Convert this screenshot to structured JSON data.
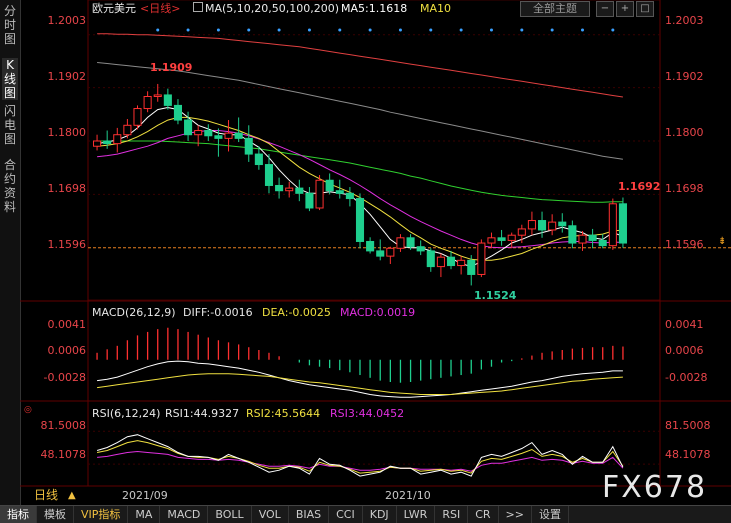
{
  "sidebar": {
    "tabs": [
      {
        "label": "分时图",
        "active": false
      },
      {
        "label": "K线图",
        "active": true
      },
      {
        "label": "闪电图",
        "active": false
      },
      {
        "label": "合约资料",
        "active": false
      }
    ]
  },
  "header": {
    "symbol": "欧元美元",
    "period": "<日线>",
    "ma_params": "MA(5,10,20,50,100,200)",
    "ma5": "MA5:1.1618",
    "ma10": "MA10",
    "theme_button": "全部主题",
    "controls": [
      "−",
      "+",
      "□"
    ]
  },
  "price_axis": {
    "labels": [
      "1.2003",
      "1.1902",
      "1.1800",
      "1.1698",
      "1.1596"
    ],
    "high_label": "1.1909",
    "low_label": "1.1524",
    "last_label": "1.1692"
  },
  "macd": {
    "title": "MACD(26,12,9)",
    "diff": "DIFF:-0.0016",
    "dea": "DEA:-0.0025",
    "macd": "MACD:0.0019",
    "axis": [
      "0.0041",
      "0.0006",
      "-0.0028"
    ]
  },
  "rsi": {
    "title": "RSI(6,12,24)",
    "rsi1": "RSI1:44.9327",
    "rsi2": "RSI2:45.5644",
    "rsi3": "RSI3:44.0452",
    "axis": [
      "81.5008",
      "48.1078"
    ]
  },
  "time_axis": {
    "period_label": "日线",
    "months": [
      "2021/09",
      "2021/10"
    ]
  },
  "bottom_tabs": [
    "指标",
    "模板",
    "VIP指标",
    "MA",
    "MACD",
    "BOLL",
    "VOL",
    "BIAS",
    "CCI",
    "KDJ",
    "LWR",
    "RSI",
    "CR",
    ">>",
    "设置"
  ],
  "watermark": "FX678",
  "colors": {
    "up": "#ff3030",
    "down": "#1ecf8e",
    "ma5": "#ffffff",
    "ma10": "#f0e040",
    "ma20": "#e030e0",
    "ma50": "#30d030",
    "ma100": "#8a8a8a",
    "ma200": "#e04040",
    "macd_dea": "#f0e040",
    "rsi2": "#f0e040",
    "rsi3": "#e030e0"
  },
  "chart_data": {
    "type": "candlestick",
    "ylim": [
      1.15,
      1.2035
    ],
    "candles": [
      {
        "o": 1.179,
        "h": 1.1812,
        "l": 1.1782,
        "c": 1.18
      },
      {
        "o": 1.18,
        "h": 1.182,
        "l": 1.1785,
        "c": 1.1795
      },
      {
        "o": 1.1795,
        "h": 1.1825,
        "l": 1.1778,
        "c": 1.1812
      },
      {
        "o": 1.1812,
        "h": 1.1842,
        "l": 1.1805,
        "c": 1.183
      },
      {
        "o": 1.183,
        "h": 1.1868,
        "l": 1.1822,
        "c": 1.1862
      },
      {
        "o": 1.1862,
        "h": 1.1895,
        "l": 1.1855,
        "c": 1.1885
      },
      {
        "o": 1.1885,
        "h": 1.1909,
        "l": 1.1875,
        "c": 1.1888
      },
      {
        "o": 1.1888,
        "h": 1.19,
        "l": 1.186,
        "c": 1.1868
      },
      {
        "o": 1.1868,
        "h": 1.188,
        "l": 1.1832,
        "c": 1.184
      },
      {
        "o": 1.184,
        "h": 1.1856,
        "l": 1.18,
        "c": 1.1812
      },
      {
        "o": 1.1812,
        "h": 1.183,
        "l": 1.179,
        "c": 1.182
      },
      {
        "o": 1.182,
        "h": 1.1832,
        "l": 1.18,
        "c": 1.181
      },
      {
        "o": 1.181,
        "h": 1.1824,
        "l": 1.177,
        "c": 1.1805
      },
      {
        "o": 1.1805,
        "h": 1.184,
        "l": 1.178,
        "c": 1.1815
      },
      {
        "o": 1.1815,
        "h": 1.1845,
        "l": 1.1798,
        "c": 1.1805
      },
      {
        "o": 1.1805,
        "h": 1.183,
        "l": 1.176,
        "c": 1.1775
      },
      {
        "o": 1.1775,
        "h": 1.179,
        "l": 1.1745,
        "c": 1.1755
      },
      {
        "o": 1.1755,
        "h": 1.1775,
        "l": 1.17,
        "c": 1.1715
      },
      {
        "o": 1.1715,
        "h": 1.173,
        "l": 1.169,
        "c": 1.1705
      },
      {
        "o": 1.1705,
        "h": 1.1722,
        "l": 1.1692,
        "c": 1.171
      },
      {
        "o": 1.171,
        "h": 1.1726,
        "l": 1.1685,
        "c": 1.17
      },
      {
        "o": 1.17,
        "h": 1.1712,
        "l": 1.1666,
        "c": 1.1672
      },
      {
        "o": 1.1672,
        "h": 1.1735,
        "l": 1.1668,
        "c": 1.1725
      },
      {
        "o": 1.1725,
        "h": 1.1738,
        "l": 1.1698,
        "c": 1.1705
      },
      {
        "o": 1.1705,
        "h": 1.1726,
        "l": 1.169,
        "c": 1.17
      },
      {
        "o": 1.17,
        "h": 1.1712,
        "l": 1.1675,
        "c": 1.169
      },
      {
        "o": 1.169,
        "h": 1.17,
        "l": 1.1595,
        "c": 1.1608
      },
      {
        "o": 1.1608,
        "h": 1.1616,
        "l": 1.1585,
        "c": 1.159
      },
      {
        "o": 1.159,
        "h": 1.1612,
        "l": 1.1572,
        "c": 1.158
      },
      {
        "o": 1.158,
        "h": 1.1598,
        "l": 1.1565,
        "c": 1.1595
      },
      {
        "o": 1.1595,
        "h": 1.1622,
        "l": 1.1588,
        "c": 1.1615
      },
      {
        "o": 1.1615,
        "h": 1.1622,
        "l": 1.1592,
        "c": 1.1598
      },
      {
        "o": 1.1598,
        "h": 1.161,
        "l": 1.1582,
        "c": 1.159
      },
      {
        "o": 1.159,
        "h": 1.1595,
        "l": 1.155,
        "c": 1.156
      },
      {
        "o": 1.156,
        "h": 1.1585,
        "l": 1.154,
        "c": 1.1578
      },
      {
        "o": 1.1578,
        "h": 1.159,
        "l": 1.1555,
        "c": 1.1562
      },
      {
        "o": 1.1562,
        "h": 1.158,
        "l": 1.1545,
        "c": 1.1572
      },
      {
        "o": 1.1572,
        "h": 1.1582,
        "l": 1.1524,
        "c": 1.1545
      },
      {
        "o": 1.1545,
        "h": 1.1612,
        "l": 1.154,
        "c": 1.1605
      },
      {
        "o": 1.1605,
        "h": 1.1625,
        "l": 1.1595,
        "c": 1.1615
      },
      {
        "o": 1.1615,
        "h": 1.163,
        "l": 1.16,
        "c": 1.161
      },
      {
        "o": 1.161,
        "h": 1.1625,
        "l": 1.1595,
        "c": 1.162
      },
      {
        "o": 1.162,
        "h": 1.164,
        "l": 1.1605,
        "c": 1.1632
      },
      {
        "o": 1.1632,
        "h": 1.1665,
        "l": 1.162,
        "c": 1.1648
      },
      {
        "o": 1.1648,
        "h": 1.1665,
        "l": 1.1615,
        "c": 1.163
      },
      {
        "o": 1.163,
        "h": 1.166,
        "l": 1.162,
        "c": 1.1645
      },
      {
        "o": 1.1645,
        "h": 1.1662,
        "l": 1.1625,
        "c": 1.1638
      },
      {
        "o": 1.1638,
        "h": 1.1648,
        "l": 1.1595,
        "c": 1.1605
      },
      {
        "o": 1.1605,
        "h": 1.1628,
        "l": 1.159,
        "c": 1.162
      },
      {
        "o": 1.162,
        "h": 1.1632,
        "l": 1.1595,
        "c": 1.161
      },
      {
        "o": 1.161,
        "h": 1.1622,
        "l": 1.1595,
        "c": 1.16
      },
      {
        "o": 1.16,
        "h": 1.169,
        "l": 1.1592,
        "c": 1.168
      },
      {
        "o": 1.168,
        "h": 1.1692,
        "l": 1.1596,
        "c": 1.1605
      }
    ],
    "ma5": [
      1.1795,
      1.1798,
      1.1802,
      1.181,
      1.1825,
      1.1845,
      1.186,
      1.1864,
      1.186,
      1.1845,
      1.183,
      1.1823,
      1.1815,
      1.1812,
      1.1812,
      1.18,
      1.1788,
      1.1768,
      1.1745,
      1.1725,
      1.1708,
      1.17,
      1.17,
      1.1703,
      1.17,
      1.1697,
      1.168,
      1.166,
      1.1636,
      1.1612,
      1.1598,
      1.1596,
      1.1596,
      1.159,
      1.1585,
      1.1576,
      1.1566,
      1.156,
      1.157,
      1.158,
      1.1592,
      1.1605,
      1.1612,
      1.162,
      1.1625,
      1.163,
      1.1635,
      1.163,
      1.1625,
      1.1615,
      1.1612,
      1.1625,
      1.1618
    ],
    "ma10": [
      1.179,
      1.1792,
      1.1795,
      1.18,
      1.1808,
      1.1818,
      1.183,
      1.184,
      1.1845,
      1.1845,
      1.1842,
      1.1838,
      1.1832,
      1.1826,
      1.182,
      1.1812,
      1.1805,
      1.1795,
      1.178,
      1.1765,
      1.175,
      1.1738,
      1.1728,
      1.1718,
      1.171,
      1.1702,
      1.1692,
      1.168,
      1.1668,
      1.1655,
      1.164,
      1.1626,
      1.1615,
      1.1603,
      1.1595,
      1.1588,
      1.158,
      1.1574,
      1.1572,
      1.1572,
      1.1575,
      1.158,
      1.1585,
      1.1593,
      1.16,
      1.1608,
      1.1615,
      1.1618,
      1.162,
      1.162,
      1.1622,
      1.1628,
      1.163
    ],
    "ma20": [
      1.177,
      1.1772,
      1.1775,
      1.178,
      1.1785,
      1.179,
      1.1797,
      1.1805,
      1.181,
      1.1815,
      1.1818,
      1.182,
      1.182,
      1.1818,
      1.1815,
      1.181,
      1.1804,
      1.1797,
      1.179,
      1.1782,
      1.1774,
      1.1765,
      1.1755,
      1.1745,
      1.1736,
      1.1726,
      1.1715,
      1.1703,
      1.169,
      1.1678,
      1.1667,
      1.1656,
      1.1646,
      1.1637,
      1.1628,
      1.162,
      1.1612,
      1.1605,
      1.16,
      1.1597,
      1.1596,
      1.1597,
      1.1598,
      1.16,
      1.1602,
      1.1605,
      1.1607,
      1.1608,
      1.1608,
      1.1606,
      1.1605,
      1.1607,
      1.1606
    ],
    "ma50": [
      1.18,
      1.18,
      1.18,
      1.18,
      1.18,
      1.18,
      1.18,
      1.1799,
      1.1798,
      1.1797,
      1.1796,
      1.1795,
      1.1793,
      1.1791,
      1.1789,
      1.1787,
      1.1785,
      1.1782,
      1.1779,
      1.1776,
      1.1773,
      1.177,
      1.1767,
      1.1764,
      1.1761,
      1.1758,
      1.1754,
      1.175,
      1.1746,
      1.1742,
      1.1738,
      1.1733,
      1.1729,
      1.1724,
      1.1719,
      1.1714,
      1.171,
      1.1706,
      1.1702,
      1.1699,
      1.1696,
      1.1694,
      1.1692,
      1.169,
      1.1688,
      1.1687,
      1.1686,
      1.1685,
      1.1684,
      1.1683,
      1.1683,
      1.1684,
      1.1684
    ],
    "ma100": [
      1.195,
      1.1948,
      1.1946,
      1.1944,
      1.1942,
      1.194,
      1.1938,
      1.1936,
      1.1934,
      1.1931,
      1.1928,
      1.1925,
      1.1922,
      1.1919,
      1.1916,
      1.1912,
      1.1908,
      1.1904,
      1.19,
      1.1896,
      1.1892,
      1.1888,
      1.1884,
      1.188,
      1.1876,
      1.1872,
      1.1868,
      1.1864,
      1.186,
      1.1855,
      1.1851,
      1.1847,
      1.1843,
      1.1839,
      1.1835,
      1.1831,
      1.1827,
      1.1823,
      1.1819,
      1.1815,
      1.1811,
      1.1807,
      1.1803,
      1.1799,
      1.1795,
      1.1791,
      1.1787,
      1.1783,
      1.1779,
      1.1775,
      1.1771,
      1.1768,
      1.1765
    ],
    "ma200": [
      1.2005,
      1.2005,
      1.2004,
      1.2004,
      1.2003,
      1.2003,
      1.2002,
      1.2001,
      1.2,
      1.1999,
      1.1998,
      1.1997,
      1.1996,
      1.1994,
      1.1992,
      1.199,
      1.1988,
      1.1986,
      1.1984,
      1.1982,
      1.198,
      1.1977,
      1.1974,
      1.1971,
      1.1968,
      1.1965,
      1.1962,
      1.1959,
      1.1956,
      1.1953,
      1.195,
      1.1947,
      1.1944,
      1.1941,
      1.1938,
      1.1935,
      1.1932,
      1.1929,
      1.1926,
      1.1923,
      1.192,
      1.1917,
      1.1914,
      1.1911,
      1.1908,
      1.1905,
      1.1902,
      1.1899,
      1.1896,
      1.1893,
      1.189,
      1.1887,
      1.1884
    ],
    "macd_ylim": [
      -0.0055,
      0.006
    ],
    "macd_hist": [
      0.001,
      0.0015,
      0.002,
      0.0028,
      0.0035,
      0.004,
      0.0044,
      0.0046,
      0.0044,
      0.004,
      0.0036,
      0.0032,
      0.0028,
      0.0025,
      0.0022,
      0.0018,
      0.0014,
      0.001,
      0.0005,
      0.0,
      -0.0004,
      -0.0008,
      -0.001,
      -0.0012,
      -0.0015,
      -0.0018,
      -0.0022,
      -0.0026,
      -0.003,
      -0.0032,
      -0.0033,
      -0.0032,
      -0.003,
      -0.0028,
      -0.0026,
      -0.0024,
      -0.0022,
      -0.002,
      -0.0014,
      -0.001,
      -0.0004,
      -0.0002,
      0.0002,
      0.0006,
      0.001,
      0.0012,
      0.0014,
      0.0016,
      0.0017,
      0.0018,
      0.0018,
      0.002,
      0.0019
    ],
    "macd_diff": [
      -0.003,
      -0.0028,
      -0.0025,
      -0.002,
      -0.0015,
      -0.001,
      -0.0006,
      -0.0003,
      -0.0002,
      -0.0003,
      -0.0005,
      -0.0006,
      -0.0008,
      -0.001,
      -0.0012,
      -0.0015,
      -0.0018,
      -0.0022,
      -0.0026,
      -0.003,
      -0.0033,
      -0.0036,
      -0.0038,
      -0.004,
      -0.0042,
      -0.0044,
      -0.0047,
      -0.005,
      -0.0052,
      -0.0053,
      -0.0054,
      -0.0054,
      -0.0053,
      -0.0052,
      -0.0051,
      -0.005,
      -0.0048,
      -0.0046,
      -0.0044,
      -0.0042,
      -0.004,
      -0.0038,
      -0.0035,
      -0.0032,
      -0.003,
      -0.0027,
      -0.0024,
      -0.0022,
      -0.002,
      -0.0019,
      -0.0018,
      -0.0016,
      -0.0016
    ],
    "macd_dea": [
      -0.004,
      -0.0038,
      -0.0036,
      -0.0034,
      -0.0032,
      -0.003,
      -0.0028,
      -0.0026,
      -0.0024,
      -0.0022,
      -0.0021,
      -0.002,
      -0.002,
      -0.002,
      -0.0021,
      -0.0022,
      -0.0023,
      -0.0024,
      -0.0026,
      -0.0028,
      -0.003,
      -0.0032,
      -0.0033,
      -0.0035,
      -0.0037,
      -0.0039,
      -0.0041,
      -0.0043,
      -0.0045,
      -0.0047,
      -0.0048,
      -0.0049,
      -0.005,
      -0.005,
      -0.005,
      -0.005,
      -0.0049,
      -0.0048,
      -0.0047,
      -0.0046,
      -0.0045,
      -0.0043,
      -0.0041,
      -0.0039,
      -0.0037,
      -0.0035,
      -0.0033,
      -0.0031,
      -0.003,
      -0.0028,
      -0.0027,
      -0.0026,
      -0.0025
    ],
    "rsi_ylim": [
      30,
      95
    ],
    "rsi1": [
      62,
      65,
      70,
      76,
      78,
      74,
      70,
      66,
      60,
      56,
      56,
      55,
      52,
      58,
      54,
      50,
      45,
      40,
      42,
      46,
      44,
      38,
      54,
      48,
      47,
      42,
      36,
      38,
      40,
      46,
      44,
      44,
      38,
      40,
      42,
      38,
      40,
      36,
      55,
      58,
      56,
      60,
      64,
      70,
      58,
      62,
      58,
      48,
      56,
      50,
      50,
      66,
      45
    ],
    "rsi2": [
      60,
      62,
      66,
      70,
      72,
      70,
      67,
      64,
      59,
      56,
      55,
      55,
      53,
      56,
      54,
      51,
      47,
      44,
      44,
      46,
      45,
      41,
      50,
      47,
      46,
      43,
      39,
      40,
      41,
      45,
      44,
      44,
      41,
      42,
      43,
      41,
      42,
      39,
      51,
      54,
      53,
      56,
      59,
      63,
      56,
      58,
      56,
      50,
      54,
      50,
      50,
      61,
      46
    ],
    "rsi3": [
      55,
      56,
      58,
      60,
      61,
      60,
      59,
      58,
      55,
      54,
      53,
      53,
      52,
      53,
      52,
      50,
      48,
      46,
      46,
      47,
      46,
      44,
      48,
      46,
      46,
      44,
      42,
      42,
      43,
      45,
      44,
      44,
      43,
      43,
      43,
      42,
      43,
      41,
      47,
      49,
      49,
      51,
      53,
      55,
      52,
      53,
      52,
      49,
      51,
      49,
      49,
      55,
      44
    ]
  }
}
